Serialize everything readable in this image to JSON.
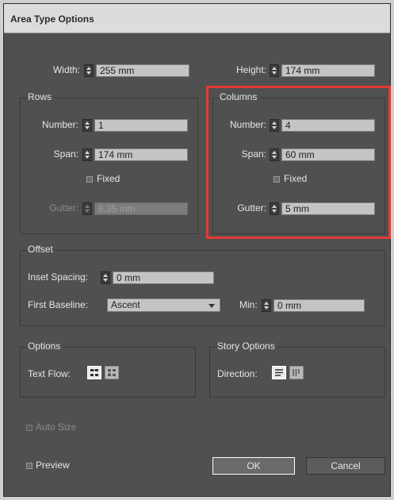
{
  "window": {
    "title": "Area Type Options"
  },
  "size": {
    "width_label": "Width:",
    "width_value": "255 mm",
    "height_label": "Height:",
    "height_value": "174 mm"
  },
  "rows": {
    "title": "Rows",
    "number_label": "Number:",
    "number_value": "1",
    "span_label": "Span:",
    "span_value": "174 mm",
    "fixed_label": "Fixed",
    "gutter_label": "Gutter:",
    "gutter_value": "6.35 mm"
  },
  "columns": {
    "title": "Columns",
    "number_label": "Number:",
    "number_value": "4",
    "span_label": "Span:",
    "span_value": "60 mm",
    "fixed_label": "Fixed",
    "gutter_label": "Gutter:",
    "gutter_value": "5 mm"
  },
  "offset": {
    "title": "Offset",
    "inset_label": "Inset Spacing:",
    "inset_value": "0 mm",
    "first_baseline_label": "First Baseline:",
    "first_baseline_value": "Ascent",
    "min_label": "Min:",
    "min_value": "0 mm"
  },
  "options": {
    "title": "Options",
    "text_flow_label": "Text Flow:",
    "text_flow_icons": [
      "text-flow-by-rows-icon",
      "text-flow-by-columns-icon"
    ]
  },
  "story_options": {
    "title": "Story Options",
    "direction_label": "Direction:",
    "direction_icons": [
      "horizontal-direction-icon",
      "vertical-direction-icon"
    ]
  },
  "auto_size_label": "Auto Size",
  "preview_label": "Preview",
  "buttons": {
    "ok": "OK",
    "cancel": "Cancel"
  },
  "colors": {
    "highlight": "#e33b34",
    "panel": "#505050"
  }
}
